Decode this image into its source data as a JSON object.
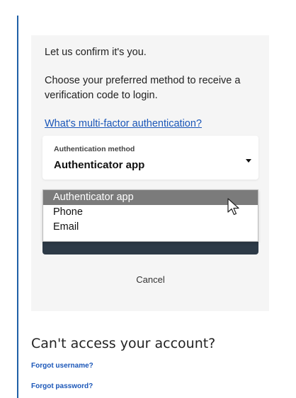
{
  "verify": {
    "intro": "Let us confirm it's you.",
    "instructions": "Choose your preferred method to receive a verification code to login.",
    "mfa_link": "What's multi-factor authentication?"
  },
  "auth_select": {
    "label": "Authentication method",
    "value": "Authenticator app",
    "options": [
      {
        "label": "Authenticator app",
        "selected": true
      },
      {
        "label": "Phone",
        "selected": false
      },
      {
        "label": "Email",
        "selected": false
      }
    ]
  },
  "actions": {
    "cancel_label": "Cancel"
  },
  "account_help": {
    "heading": "Can't access your account?",
    "forgot_username": "Forgot username?",
    "forgot_password": "Forgot password?"
  },
  "colors": {
    "accent_rule": "#1f5fa6",
    "link": "#1a56b8",
    "selected_option_bg": "#7b7b7b",
    "submit_bar": "#2d3a47",
    "card_bg": "#f5f5f5"
  },
  "icons": {
    "caret": "caret-down-icon",
    "cursor": "mouse-pointer-icon"
  }
}
